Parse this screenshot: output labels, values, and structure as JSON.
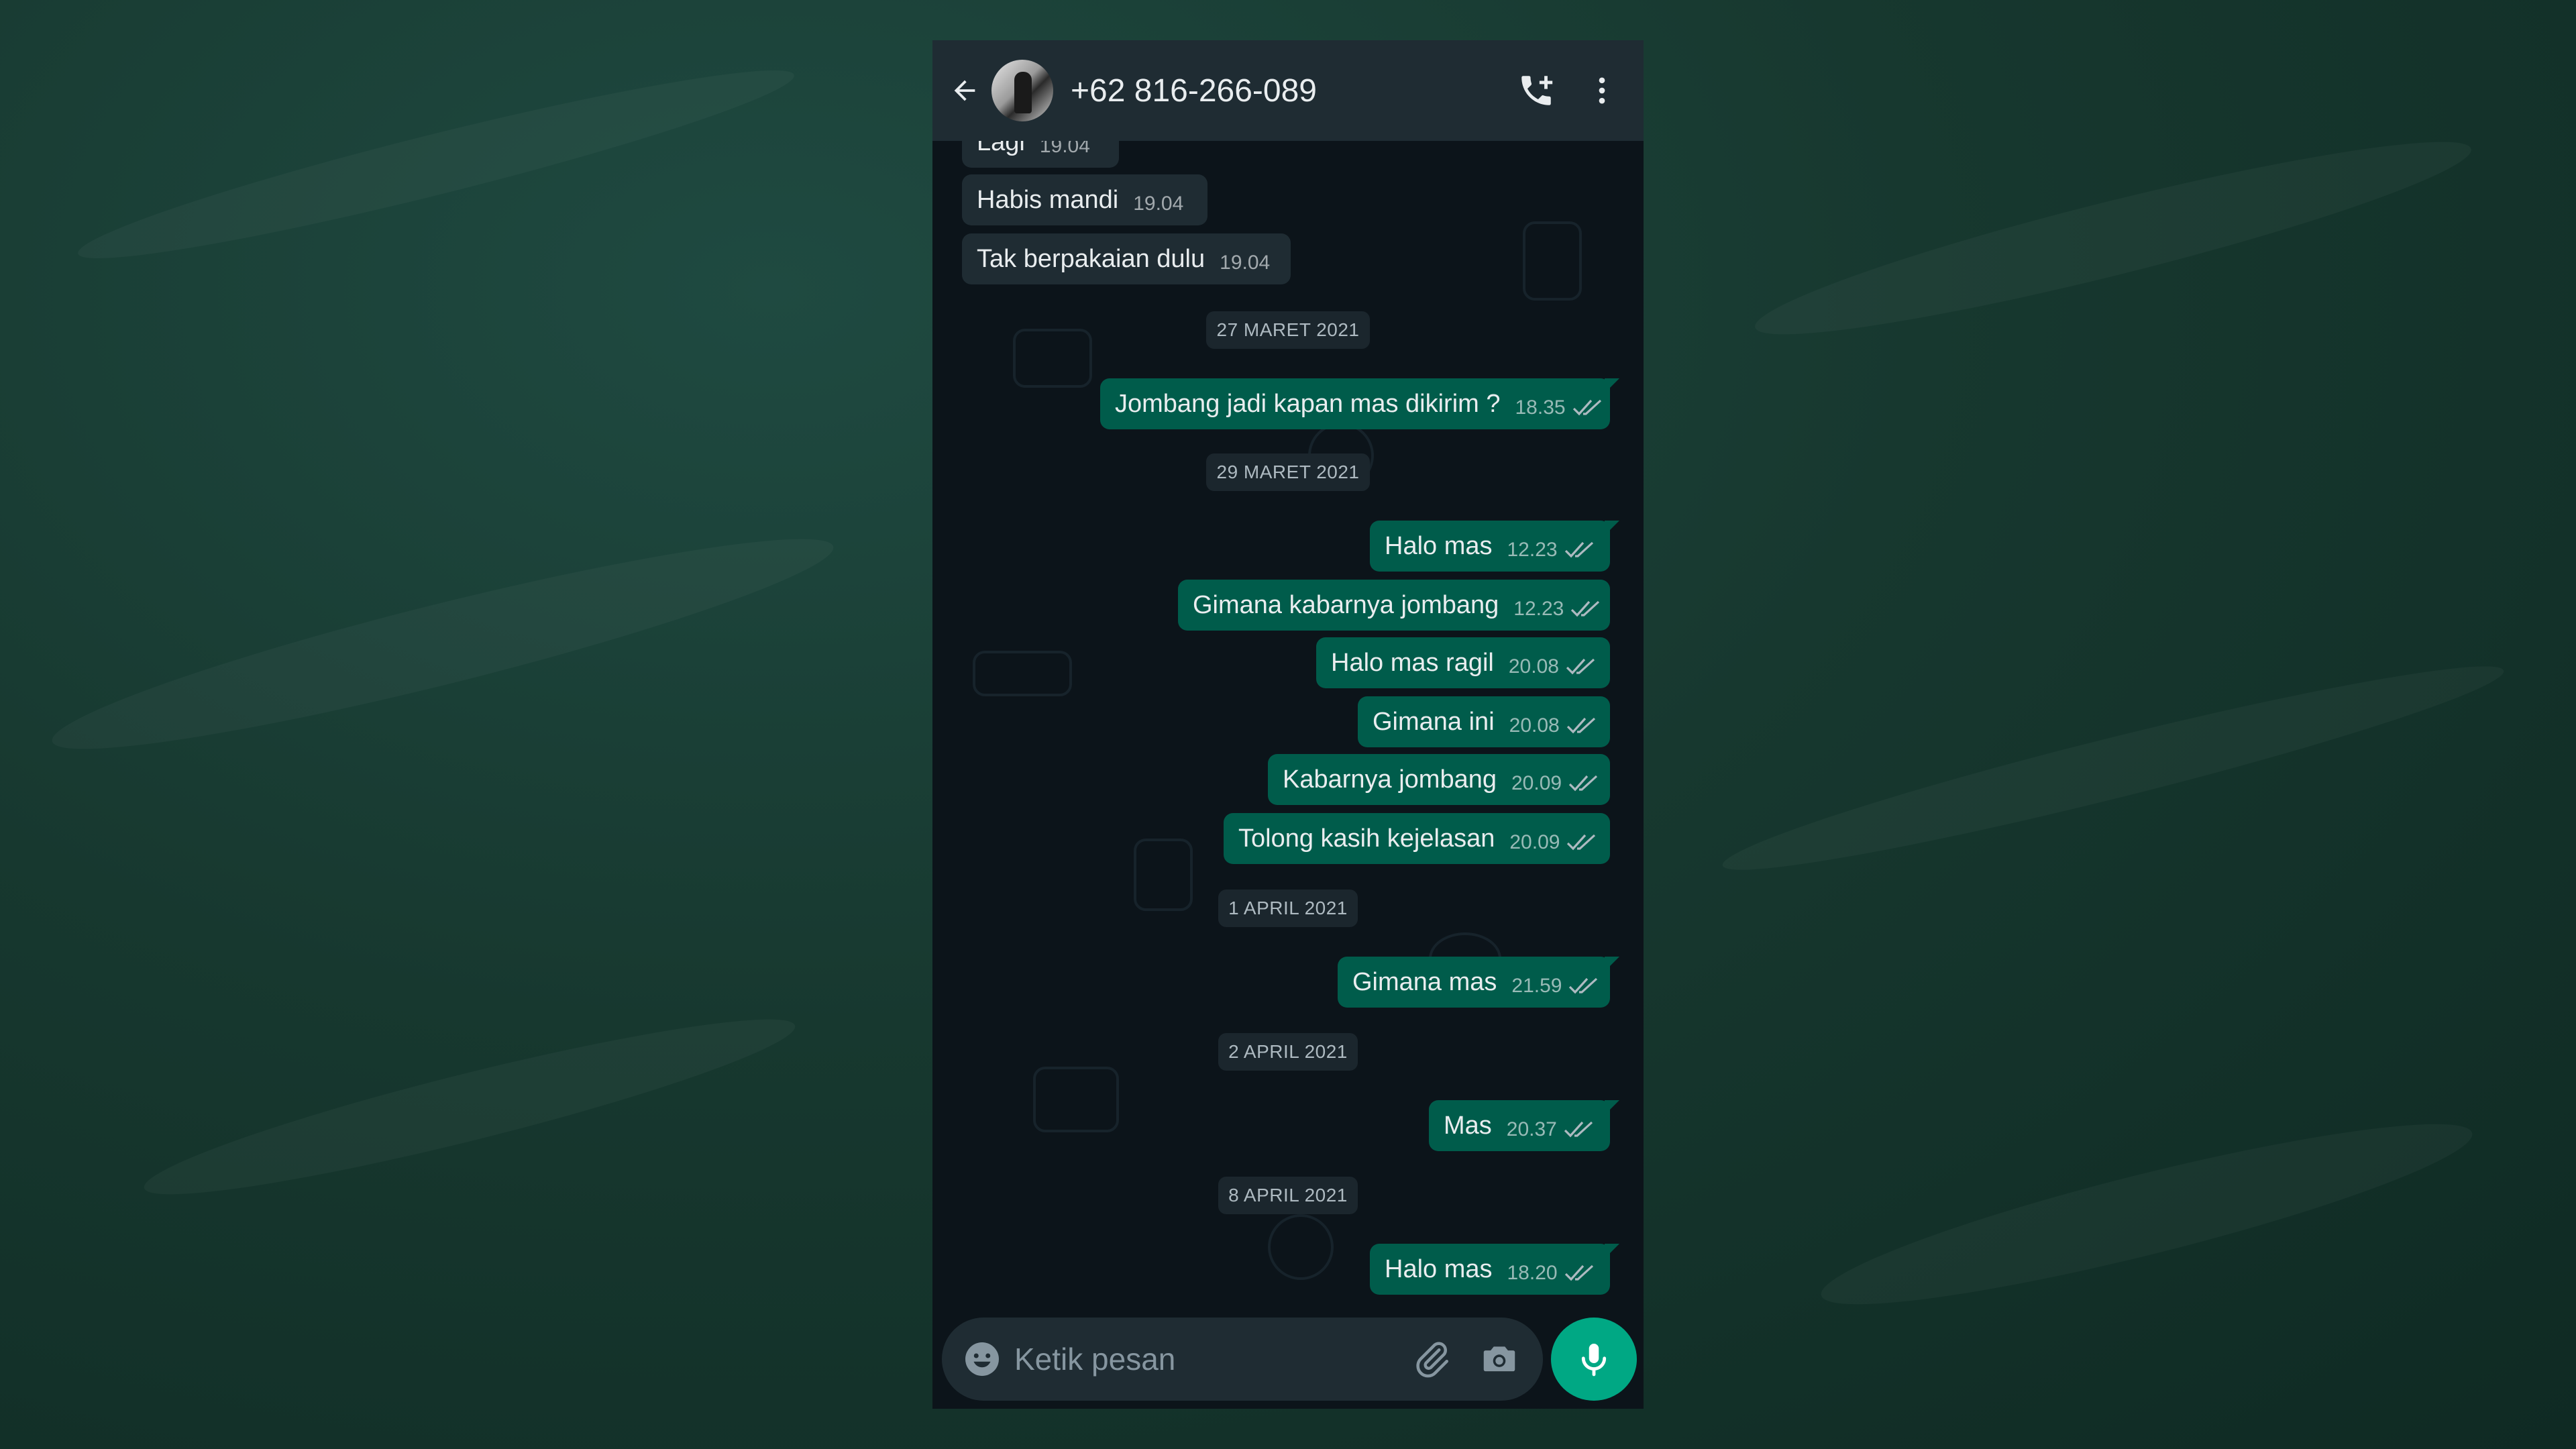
{
  "header": {
    "contact_name": "+62 816-266-089"
  },
  "messages": [
    {
      "type": "in",
      "text": "Lagi",
      "time": "19.04"
    },
    {
      "type": "in",
      "text": "Habis mandi",
      "time": "19.04"
    },
    {
      "type": "in",
      "text": "Tak berpakaian dulu",
      "time": "19.04"
    },
    {
      "type": "date",
      "text": "27 MARET 2021"
    },
    {
      "type": "out",
      "text": "Jombang jadi kapan mas dikirim ?",
      "time": "18.35",
      "status": "read"
    },
    {
      "type": "date",
      "text": "29 MARET 2021"
    },
    {
      "type": "out",
      "text": "Halo mas",
      "time": "12.23",
      "status": "read"
    },
    {
      "type": "out",
      "text": "Gimana kabarnya jombang",
      "time": "12.23",
      "status": "read"
    },
    {
      "type": "out",
      "text": "Halo mas ragil",
      "time": "20.08",
      "status": "read"
    },
    {
      "type": "out",
      "text": "Gimana ini",
      "time": "20.08",
      "status": "read"
    },
    {
      "type": "out",
      "text": "Kabarnya jombang",
      "time": "20.09",
      "status": "read"
    },
    {
      "type": "out",
      "text": "Tolong kasih kejelasan",
      "time": "20.09",
      "status": "read"
    },
    {
      "type": "date",
      "text": "1 APRIL 2021"
    },
    {
      "type": "out",
      "text": "Gimana mas",
      "time": "21.59",
      "status": "read"
    },
    {
      "type": "date",
      "text": "2 APRIL 2021"
    },
    {
      "type": "out",
      "text": "Mas",
      "time": "20.37",
      "status": "read"
    },
    {
      "type": "date",
      "text": "8 APRIL 2021"
    },
    {
      "type": "out",
      "text": "Halo mas",
      "time": "18.20",
      "status": "read"
    }
  ],
  "composer": {
    "placeholder": "Ketik pesan"
  },
  "icons": {
    "back": "arrow-left-icon",
    "call": "add-call-icon",
    "menu": "more-vertical-icon",
    "emoji": "emoji-icon",
    "attach": "paperclip-icon",
    "camera": "camera-icon",
    "mic": "microphone-icon",
    "read_status": "double-check-icon"
  },
  "colors": {
    "header_bg": "#1f2c33",
    "chat_bg": "#0c141a",
    "incoming_bubble": "#1f2c33",
    "outgoing_bubble": "#005c4b",
    "accent": "#00a884",
    "read_ticks": "#aebac1"
  }
}
